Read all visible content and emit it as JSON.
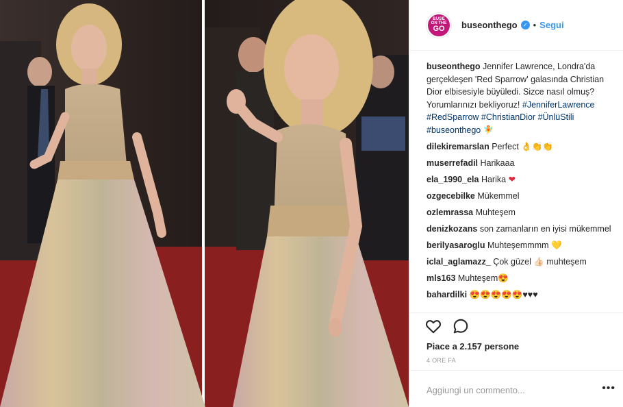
{
  "post": {
    "username": "buseonthego",
    "follow_label": "Segui",
    "dot": "•",
    "avatar_text": [
      "BUSE",
      "ON THE",
      "GO"
    ]
  },
  "caption": {
    "username": "buseonthego",
    "text": "Jennifer Lawrence, Londra'da gerçekleşen 'Red Sparrow' galasında Christian Dior elbisesiyle büyüledi. Sizce nasıl olmuş? Yorumlarınızı bekliyoruz!",
    "hashtags": "#JenniferLawrence #RedSparrow #ChristianDior #ÜnlüStili #buseonthego",
    "emoji": "🧚"
  },
  "comments": [
    {
      "user": "dilekiremarslan",
      "text": "Perfect 👌👏👏"
    },
    {
      "user": "muserrefadil",
      "text": "Harikaaa"
    },
    {
      "user": "ela_1990_ela",
      "text": "Harika",
      "heart": "❤"
    },
    {
      "user": "ozgecebilke",
      "text": "Mükemmel"
    },
    {
      "user": "ozlemrassa",
      "text": "Muhteşem"
    },
    {
      "user": "denizkozans",
      "text": "son zamanların en iyisi mükemmel"
    },
    {
      "user": "berilyasaroglu",
      "text": "Muhteşemmmm 💛"
    },
    {
      "user": "iclal_aglamazz_",
      "text": "Çok güzel 👍🏻 muhteşem"
    },
    {
      "user": "mls163",
      "text": "Muhteşem😍"
    },
    {
      "user": "bahardilki",
      "text": "😍😍😍😍😍♥♥♥"
    }
  ],
  "likes": "Piace a 2.157 persone",
  "time": "4 ORE FA",
  "comment_placeholder": "Aggiungi un commento...",
  "more_icon": "•••",
  "colors": {
    "accent": "#3897f0",
    "avatar": "#c2187a",
    "hashtag": "#003569"
  }
}
